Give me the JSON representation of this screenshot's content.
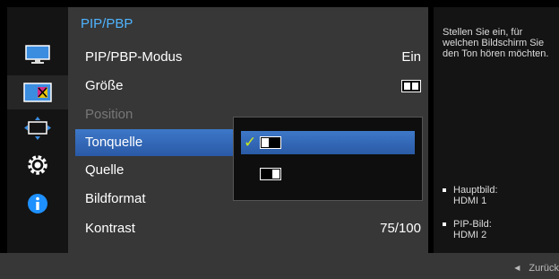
{
  "menu": {
    "title": "PIP/PBP",
    "items": [
      {
        "label": "PIP/PBP-Modus",
        "value": "Ein"
      },
      {
        "label": "Größe",
        "value_icon": "pbp-split-icon"
      },
      {
        "label": "Position",
        "disabled": true
      },
      {
        "label": "Tonquelle",
        "selected": true
      },
      {
        "label": "Quelle"
      },
      {
        "label": "Bildformat"
      },
      {
        "label": "Kontrast",
        "value": "75/100"
      }
    ]
  },
  "submenu": {
    "options": [
      {
        "icon": "pbp-left-window-icon",
        "checked": true
      },
      {
        "icon": "pbp-right-window-icon",
        "checked": false
      }
    ]
  },
  "help": {
    "text": "Stellen Sie ein, für welchen Bildschirm Sie den Ton hören möchten.",
    "sources": [
      {
        "line1": "Hauptbild:",
        "line2": "HDMI 1"
      },
      {
        "line1": "PIP-Bild:",
        "line2": "HDMI 2"
      }
    ]
  },
  "footer": {
    "back_label": "Zurück"
  },
  "sidebar": {
    "icons": [
      "monitor-icon",
      "color-icon",
      "screen-adjust-icon",
      "settings-gear-icon",
      "information-icon"
    ],
    "active_index": 1
  },
  "colors": {
    "highlight": "#2f66b8",
    "title": "#4fb4ff",
    "check": "#c8e620",
    "info": "#1e90ff"
  }
}
